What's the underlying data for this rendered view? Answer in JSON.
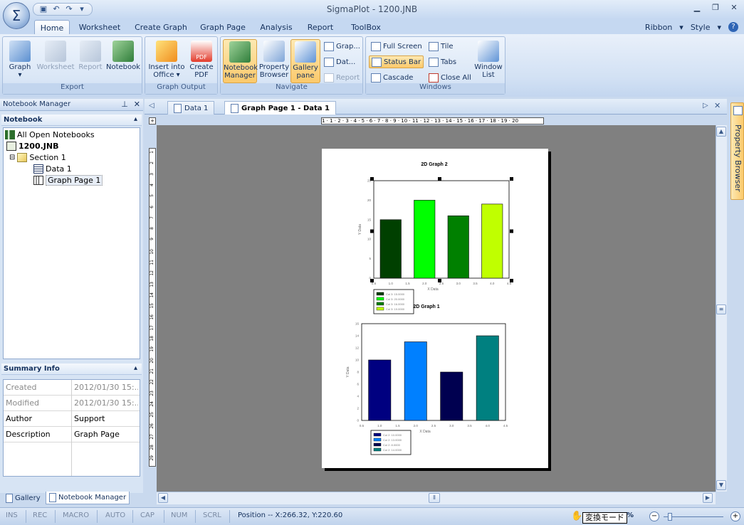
{
  "window": {
    "title": "SigmaPlot - 1200.JNB",
    "app_icon": "sigma-icon"
  },
  "qat": {
    "save": "save-icon",
    "undo": "undo-icon",
    "redo": "redo-icon",
    "more": "▾"
  },
  "tabs": [
    {
      "label": "Home",
      "active": true
    },
    {
      "label": "Worksheet"
    },
    {
      "label": "Create Graph"
    },
    {
      "label": "Graph Page"
    },
    {
      "label": "Analysis"
    },
    {
      "label": "Report"
    },
    {
      "label": "ToolBox"
    }
  ],
  "ribbon_right": {
    "ribbon": "Ribbon",
    "style": "Style",
    "help": "?"
  },
  "groups": {
    "export": {
      "label": "Export",
      "buttons": [
        {
          "label": "Graph",
          "sub": "▾",
          "enabled": true
        },
        {
          "label": "Worksheet",
          "enabled": false
        },
        {
          "label": "Report",
          "enabled": false
        },
        {
          "label": "Notebook",
          "enabled": true
        }
      ]
    },
    "graph_output": {
      "label": "Graph Output",
      "buttons": [
        {
          "label": "Insert into",
          "label2": "Office ▾"
        },
        {
          "label": "Create",
          "label2": "PDF"
        }
      ]
    },
    "navigate": {
      "label": "Navigate",
      "buttons": [
        {
          "label": "Notebook",
          "label2": "Manager",
          "selected": true
        },
        {
          "label": "Property",
          "label2": "Browser"
        },
        {
          "label": "Gallery",
          "label2": "pane",
          "selected": true
        }
      ],
      "small": [
        {
          "label": "Grap..."
        },
        {
          "label": "Dat..."
        },
        {
          "label": "Report",
          "enabled": false
        }
      ]
    },
    "windows": {
      "label": "Windows",
      "small": [
        {
          "label": "Full Screen"
        },
        {
          "label": "Tile"
        },
        {
          "label": "Status Bar",
          "selected": true
        },
        {
          "label": "Tabs"
        },
        {
          "label": "Cascade"
        },
        {
          "label": "Close All"
        }
      ],
      "big": {
        "label": "Window",
        "label2": "List"
      }
    }
  },
  "notebook_manager": {
    "title": "Notebook Manager",
    "pin": "pin-icon",
    "close": "✕",
    "section_title": "Notebook",
    "tree": [
      {
        "label": "All Open Notebooks",
        "level": 0,
        "icon": "notebooks-icon"
      },
      {
        "label": "1200.JNB",
        "level": 0,
        "icon": "notebook-icon",
        "bold": true
      },
      {
        "label": "Section 1",
        "level": 1,
        "icon": "section-icon",
        "toggle": "⊟"
      },
      {
        "label": "Data 1",
        "level": 2,
        "icon": "worksheet-icon"
      },
      {
        "label": "Graph Page 1",
        "level": 2,
        "icon": "graph-page-icon",
        "selected": true
      }
    ],
    "summary_title": "Summary Info",
    "summary": [
      {
        "key": "Created",
        "value": "2012/01/30 15:...",
        "enabled": false
      },
      {
        "key": "Modified",
        "value": "2012/01/30 15:...",
        "enabled": false
      },
      {
        "key": "Author",
        "value": "Support",
        "enabled": true
      },
      {
        "key": "Description",
        "value": "Graph Page",
        "enabled": true
      }
    ],
    "bottom_tabs": [
      {
        "label": "Gallery"
      },
      {
        "label": "Notebook Manager",
        "active": true
      }
    ]
  },
  "document_tabs": [
    {
      "label": "Data 1",
      "active": false
    },
    {
      "label": "Graph Page 1 - Data 1",
      "active": true
    }
  ],
  "ruler_h": "1 · 1 · 2 · 3 · 4 · 5 · 6 · 7 · 8 · 9 · 10 · 11 · 12 · 13 · 14 · 15 · 16 · 17 · 18 · 19 · 20",
  "ruler_v": [
    "1",
    "2",
    "3",
    "4",
    "5",
    "6",
    "7",
    "8",
    "9",
    "10",
    "11",
    "12",
    "13",
    "14",
    "15",
    "16",
    "17",
    "18",
    "19",
    "20",
    "21",
    "22",
    "23",
    "24",
    "25",
    "26",
    "27",
    "28",
    "29"
  ],
  "chart_data": [
    {
      "type": "bar",
      "title": "2D Graph 2",
      "xlabel": "X Data",
      "ylabel": "Y Data",
      "x": [
        1.0,
        2.0,
        3.0,
        4.0
      ],
      "values": [
        15,
        20,
        16,
        19
      ],
      "colors": [
        "#004000",
        "#00ff00",
        "#008000",
        "#c0ff00"
      ],
      "xticks": [
        "0.5",
        "1.0",
        "1.5",
        "2.0",
        "2.5",
        "3.0",
        "3.5",
        "4.0",
        "4.5"
      ],
      "yticks": [
        "0",
        "5",
        "10",
        "15",
        "20",
        "25"
      ],
      "xlim": [
        0.5,
        4.5
      ],
      "ylim": [
        0,
        25
      ],
      "legend": [
        "Col 3: 15.0000",
        "Col 3: 20.0000",
        "Col 3: 16.0000",
        "Col 3: 19.0000"
      ],
      "legend_position": "bottom-left"
    },
    {
      "type": "bar",
      "title": "2D Graph 1",
      "xlabel": "X Data",
      "ylabel": "Y Data",
      "x": [
        1.0,
        2.0,
        3.0,
        4.0
      ],
      "values": [
        10,
        13,
        8,
        14
      ],
      "colors": [
        "#000080",
        "#0080ff",
        "#000050",
        "#008080"
      ],
      "xticks": [
        "0.5",
        "1.0",
        "1.5",
        "2.0",
        "2.5",
        "3.0",
        "3.5",
        "4.0",
        "4.5"
      ],
      "yticks": [
        "0",
        "2",
        "4",
        "6",
        "8",
        "10",
        "12",
        "14",
        "16"
      ],
      "xlim": [
        0.5,
        4.5
      ],
      "ylim": [
        0,
        16
      ],
      "legend": [
        "Col 2: 10.0000",
        "Col 2: 13.0000",
        "Col 2: 8.0000",
        "Col 2: 14.0000"
      ],
      "legend_position": "bottom-left"
    }
  ],
  "property_browser": {
    "label": "Property Browser"
  },
  "status": {
    "items": [
      "INS",
      "REC",
      "MACRO",
      "AUTO",
      "CAP",
      "NUM",
      "SCRL"
    ],
    "position": "Position -- X:266.32, Y:220.60",
    "ime": "変換モード",
    "zoom_suffix": "%"
  }
}
